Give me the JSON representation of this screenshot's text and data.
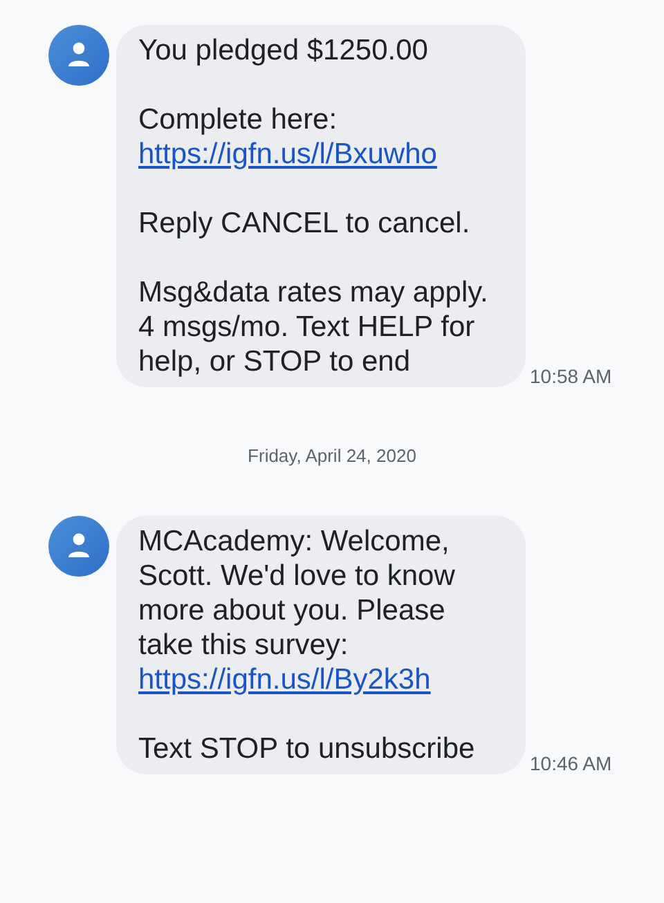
{
  "conversation": [
    {
      "kind": "message",
      "time": "10:58 AM",
      "paragraphs": [
        {
          "text": "You pledged $1250.00"
        },
        {
          "text": "Complete here:",
          "link": "https://igfn.us/l/Bxuwho"
        },
        {
          "text": "Reply CANCEL to cancel."
        },
        {
          "text": "Msg&data rates may apply. 4 msgs/mo. Text HELP for help, or STOP to end"
        }
      ]
    },
    {
      "kind": "date",
      "text": "Friday, April 24, 2020"
    },
    {
      "kind": "message",
      "time": "10:46 AM",
      "paragraphs": [
        {
          "text": "MCAcademy: Welcome, Scott. We'd love to know more about you. Please take this survey:",
          "link": "https://igfn.us/l/By2k3h"
        },
        {
          "text": "Text STOP to unsubscribe"
        }
      ]
    }
  ]
}
